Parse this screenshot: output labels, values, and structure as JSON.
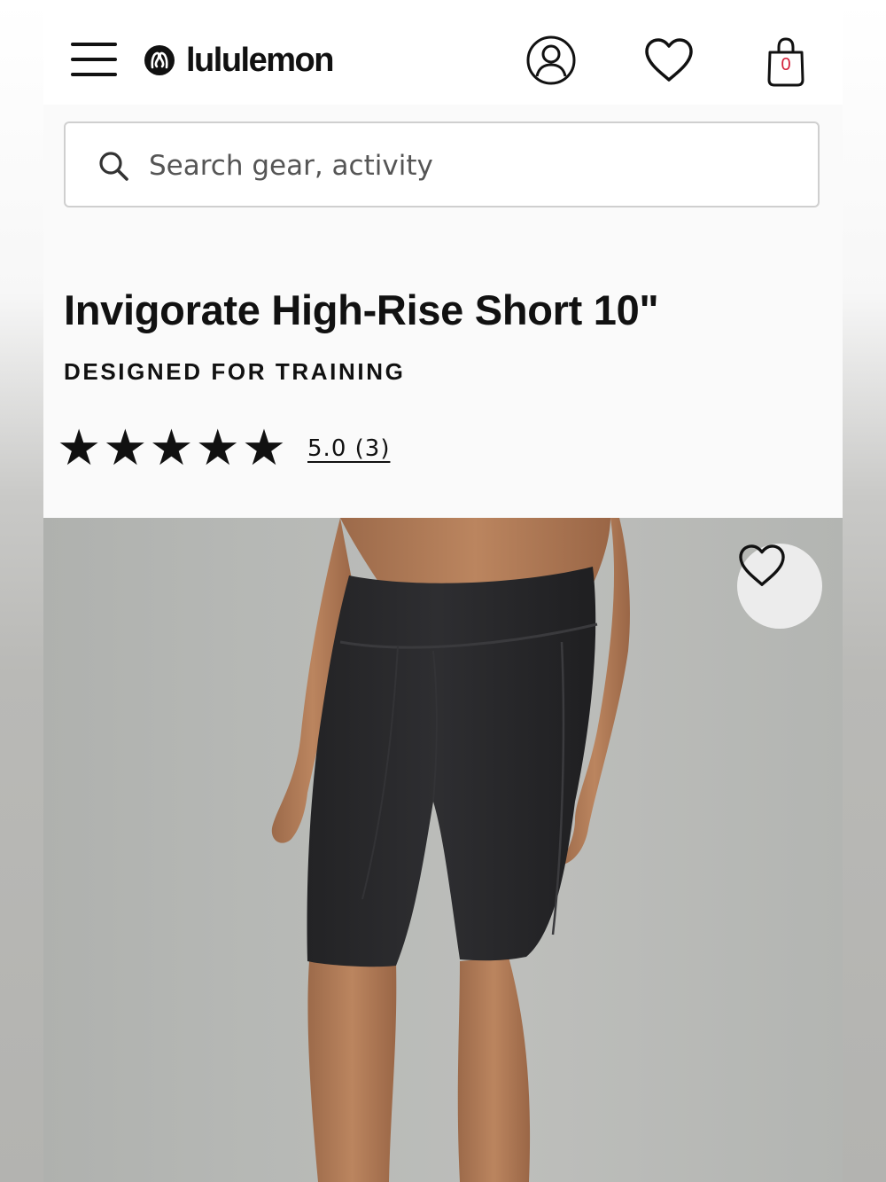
{
  "header": {
    "brand": "lululemon",
    "bag_count": "0"
  },
  "search": {
    "placeholder": "Search gear, activity",
    "value": ""
  },
  "product": {
    "title": "Invigorate High-Rise Short 10\"",
    "tagline": "DESIGNED FOR TRAINING",
    "rating": {
      "stars": 5,
      "label": "5.0 (3)"
    }
  },
  "colors": {
    "accent": "#d31f3a",
    "text": "#111111",
    "image_background": "#b7b9b6",
    "short_color": "#2b2b2d",
    "skin_tone": "#b47d59"
  },
  "icons": {
    "menu": "hamburger-menu-icon",
    "account": "account-icon",
    "wishlist": "heart-icon",
    "bag": "shopping-bag-icon",
    "search": "search-icon",
    "star": "star-icon"
  }
}
